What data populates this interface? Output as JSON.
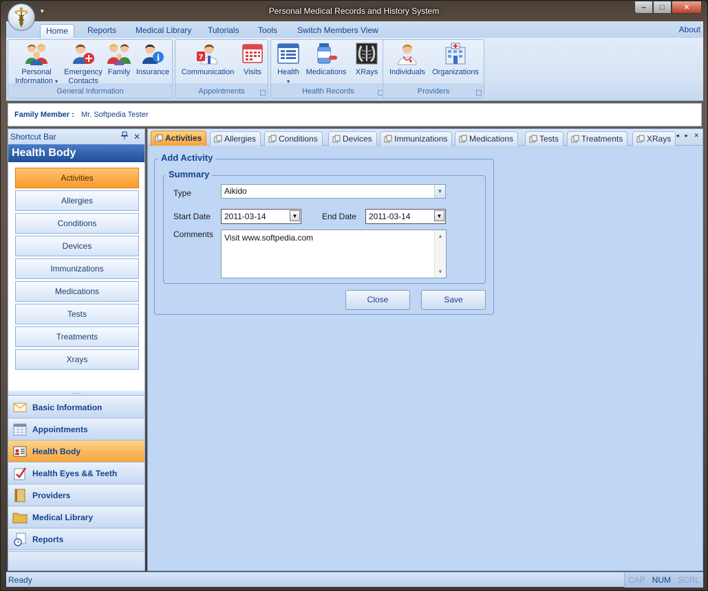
{
  "window": {
    "title": "Personal Medical Records and History System",
    "controls": {
      "minimize": "‒",
      "maximize": "□",
      "close": "✕"
    }
  },
  "ribbon": {
    "tabs": [
      "Home",
      "Reports",
      "Medical Library",
      "Tutorials",
      "Tools",
      "Switch Members View"
    ],
    "active_tab": "Home",
    "about": "About",
    "groups": [
      {
        "label": "General Information",
        "buttons": [
          {
            "label": "Personal",
            "label2": "Information",
            "icon": "people-icon",
            "dropdown": "▾"
          },
          {
            "label": "Emergency",
            "label2": "Contacts",
            "icon": "emergency-contacts-icon"
          },
          {
            "label": "Family",
            "label2": "",
            "icon": "family-icon"
          },
          {
            "label": "Insurance",
            "label2": "",
            "icon": "insurance-icon"
          }
        ]
      },
      {
        "label": "Appointments",
        "buttons": [
          {
            "label": "Communication",
            "label2": "",
            "icon": "communication-icon"
          },
          {
            "label": "Visits",
            "label2": "",
            "icon": "calendar-icon"
          }
        ]
      },
      {
        "label": "Health Records",
        "buttons": [
          {
            "label": "Health",
            "label2": "",
            "icon": "health-records-icon",
            "dropdown": "▾"
          },
          {
            "label": "Medications",
            "label2": "",
            "icon": "medications-icon"
          },
          {
            "label": "XRays",
            "label2": "",
            "icon": "xray-icon"
          }
        ]
      },
      {
        "label": "Providers",
        "buttons": [
          {
            "label": "Individuals",
            "label2": "",
            "icon": "doctor-icon"
          },
          {
            "label": "Organizations",
            "label2": "",
            "icon": "hospital-icon"
          }
        ]
      }
    ]
  },
  "member_bar": {
    "label": "Family Member :",
    "value": "Mr. Softpedia Tester"
  },
  "shortcut_bar": {
    "header": "Shortcut Bar",
    "pin": "📌",
    "close": "✕",
    "title": "Health Body",
    "items": [
      "Activities",
      "Allergies",
      "Conditions",
      "Devices",
      "Immunizations",
      "Medications",
      "Tests",
      "Treatments",
      "Xrays"
    ],
    "active_item": "Activities",
    "grip": "......",
    "nav": [
      {
        "label": "Basic Information",
        "icon": "mail-icon"
      },
      {
        "label": "Appointments",
        "icon": "calendar-grid-icon"
      },
      {
        "label": "Health Body",
        "icon": "id-card-icon",
        "active": true
      },
      {
        "label": "Health Eyes && Teeth",
        "icon": "checklist-icon"
      },
      {
        "label": "Providers",
        "icon": "book-icon"
      },
      {
        "label": "Medical Library",
        "icon": "folder-icon"
      },
      {
        "label": "Reports",
        "icon": "report-clock-icon"
      }
    ]
  },
  "doc_tabs": {
    "tabs": [
      "Activities",
      "Allergies",
      "Conditions",
      "Devices",
      "Immunizations",
      "Medications",
      "Tests",
      "Treatments",
      "XRays"
    ],
    "active": "Activities",
    "controls": "◂ ▸ ✕"
  },
  "form": {
    "group_title": "Add Activity",
    "summary_title": "Summary",
    "type_label": "Type",
    "type_value": "Aikido",
    "start_label": "Start Date",
    "start_value": "2011-03-14",
    "end_label": "End Date",
    "end_value": "2011-03-14",
    "comments_label": "Comments",
    "comments_value": "Visit www.softpedia.com",
    "close_button": "Close",
    "save_button": "Save"
  },
  "status": {
    "text": "Ready",
    "indicators": [
      {
        "label": "CAP",
        "on": false
      },
      {
        "label": "NUM",
        "on": true
      },
      {
        "label": "SCRL",
        "on": false
      }
    ]
  }
}
